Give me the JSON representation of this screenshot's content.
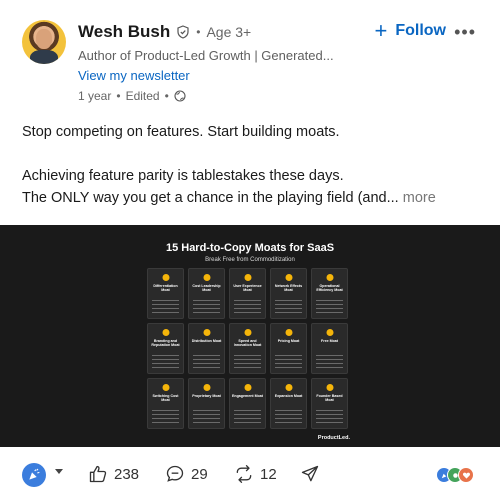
{
  "author": {
    "name": "Wesh Bush",
    "age": "Age 3+",
    "headline": "Author of Product-Led Growth | Generated...",
    "newsletter_link": "View my newsletter",
    "time": "1 year",
    "edited": "Edited"
  },
  "follow": {
    "label": "Follow"
  },
  "post": {
    "line1": "Stop competing on features. Start building moats.",
    "line2": "Achieving feature parity is tablestakes these days.",
    "line3": "The ONLY way you get a chance in the playing field (and...",
    "see_more": "more"
  },
  "image": {
    "title": "15 Hard-to-Copy Moats for SaaS",
    "subtitle": "Break Free from Commoditization",
    "brand": "ProductLed.",
    "cards": [
      {
        "title": "Differentiation Moat"
      },
      {
        "title": "Cost Leadership Moat"
      },
      {
        "title": "User Experience Moat"
      },
      {
        "title": "Network Effects Moat"
      },
      {
        "title": "Operational Efficiency Moat"
      },
      {
        "title": "Branding and Reputation Moat"
      },
      {
        "title": "Distribution Moat"
      },
      {
        "title": "Speed and Innovation Moat"
      },
      {
        "title": "Pricing Moat"
      },
      {
        "title": "Free Moat"
      },
      {
        "title": "Switching Cost Moat"
      },
      {
        "title": "Proprietary Moat"
      },
      {
        "title": "Engagement Moat"
      },
      {
        "title": "Expansion Moat"
      },
      {
        "title": "Founder Based Moat"
      }
    ]
  },
  "actions": {
    "likes": "238",
    "comments": "29",
    "reposts": "12"
  },
  "colors": {
    "accent": "#0a66c2",
    "moat_icon": "#f5b50a",
    "image_bg": "#1a1a1a"
  }
}
